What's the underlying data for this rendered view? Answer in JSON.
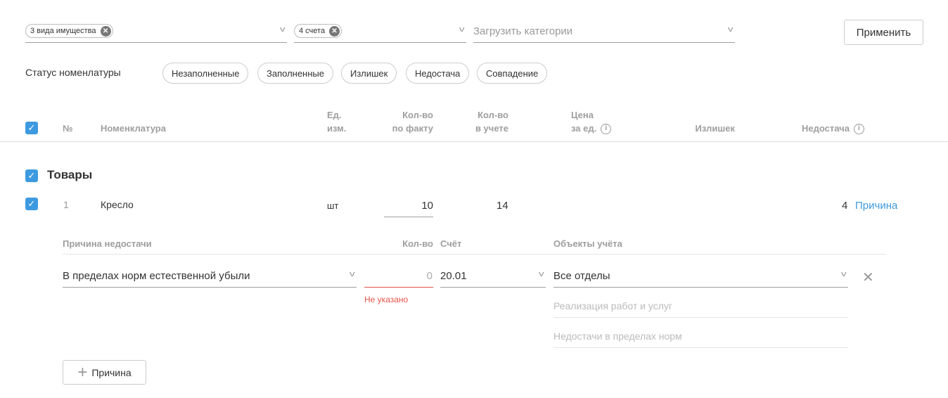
{
  "filters": {
    "property_tag": "3 вида имущества",
    "accounts_tag": "4 счета",
    "categories_placeholder": "Загрузить категории",
    "apply": "Применить"
  },
  "status": {
    "label": "Статус номенлатуры",
    "chips": [
      "Незаполненные",
      "Заполненные",
      "Излишек",
      "Недостача",
      "Совпадение"
    ]
  },
  "columns": {
    "num": "№",
    "name": "Номенклатура",
    "unit1": "Ед.",
    "unit2": "изм.",
    "fact1": "Кол-во",
    "fact2": "по факту",
    "acc1": "Кол-во",
    "acc2": "в учете",
    "price1": "Цена",
    "price2": "за ед.",
    "surplus": "Излишек",
    "shortage": "Недостача"
  },
  "group": {
    "title": "Товары"
  },
  "row": {
    "num": "1",
    "name": "Кресло",
    "unit": "шт",
    "fact": "10",
    "accounted": "14",
    "shortage": "4",
    "reason_link": "Причина"
  },
  "reason": {
    "h_reason": "Причина недостачи",
    "h_qty": "Кол-во",
    "h_account": "Счёт",
    "h_objects": "Объекты учёта",
    "reason_value": "В пределах норм естественной убыли",
    "qty_placeholder": "0",
    "qty_error": "Не указано",
    "account_value": "20.01",
    "objects_value": "Все отделы",
    "obj_placeholder1": "Реализация работ и услуг",
    "obj_placeholder2": "Недостачи в пределах норм",
    "add_reason": "Причина"
  }
}
